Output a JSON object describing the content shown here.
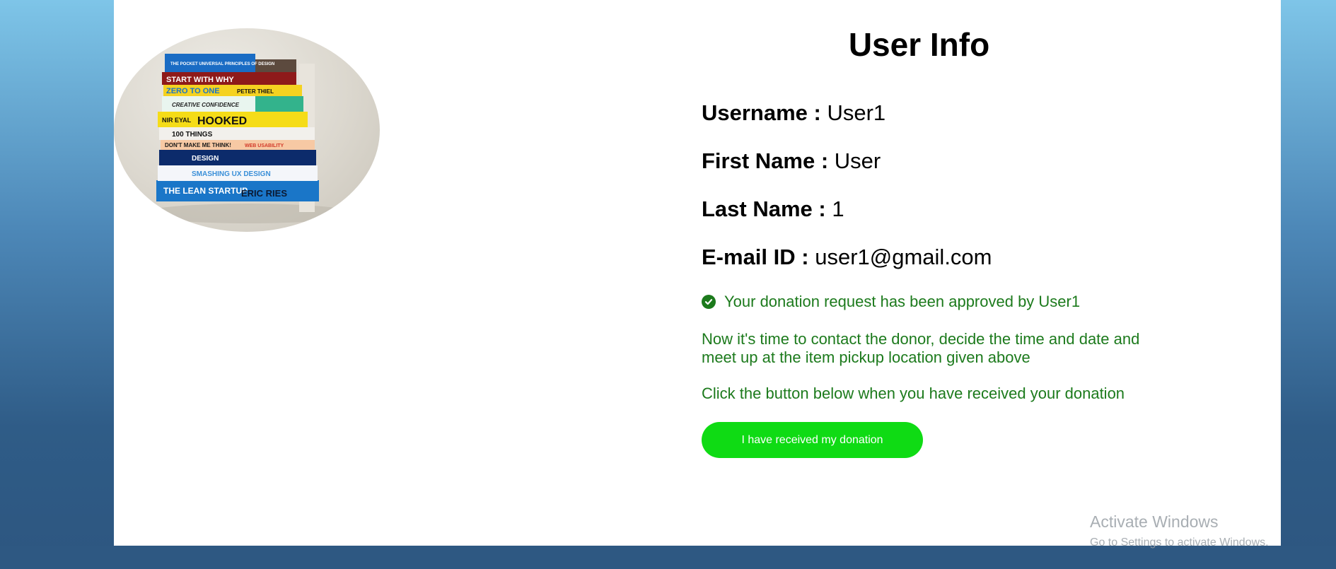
{
  "user_info": {
    "title": "User Info",
    "fields": [
      {
        "label": "Username :",
        "value": "User1"
      },
      {
        "label": "First Name :",
        "value": "User"
      },
      {
        "label": "Last Name :",
        "value": "1"
      },
      {
        "label": "E-mail ID :",
        "value": "user1@gmail.com"
      }
    ]
  },
  "donation": {
    "approved_icon": "check-circle-icon",
    "approved_text": "Your donation request has been approved by User1",
    "contact_text": "Now it's time to contact the donor, decide the time and date and meet up at the item pickup location given above",
    "instruction_text": "Click the button below when you have received your donation",
    "button_label": "I have received my donation"
  },
  "book_image": {
    "description_icon": "book-stack-photo",
    "spines": [
      "THE POCKET UNIVERSAL PRINCIPLES OF DESIGN",
      "START WITH WHY",
      "ZERO TO ONE",
      "PETER THIEL",
      "CREATIVE CONFIDENCE",
      "NIR EYAL",
      "HOOKED",
      "100 THINGS",
      "DON'T MAKE ME THINK!",
      "WEB USABILITY",
      "DESIGN",
      "SMASHING UX DESIGN",
      "THE LEAN STARTUP",
      "ERIC RIES"
    ]
  },
  "watermark": {
    "title": "Activate Windows",
    "subtitle": "Go to Settings to activate Windows."
  },
  "colors": {
    "success_text": "#1c7a1c",
    "button_bg": "#0fdb14",
    "button_text": "#ffffff"
  }
}
